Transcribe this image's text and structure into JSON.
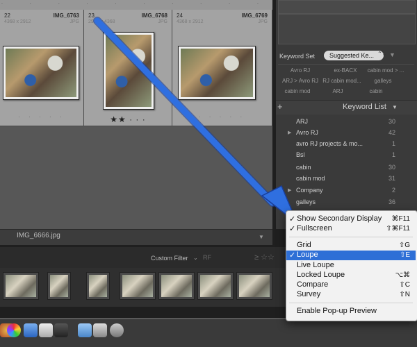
{
  "grid": {
    "top_dots": "· · · · · · · · · · · ·",
    "cells": [
      {
        "num": "22",
        "name": "IMG_6763",
        "dims": "4368 x 2912",
        "type": "JPG",
        "dots": "· · · · ·",
        "stars": ""
      },
      {
        "num": "23",
        "name": "IMG_6768",
        "dims": "2912 x 4368",
        "type": "JPG",
        "dots": "",
        "stars": "★★ · · ·"
      },
      {
        "num": "24",
        "name": "IMG_6769",
        "dims": "4368 x 2912",
        "type": "JPG",
        "dots": "· · · · ·",
        "stars": ""
      }
    ]
  },
  "status": {
    "filename": "IMG_6666.jpg"
  },
  "keyword_set": {
    "label": "Keyword Set",
    "value": "Suggested Ke...",
    "chevron": "⌃⌄",
    "suggestions": [
      "Avro RJ",
      "ex-BACX",
      "cabin mod > ...",
      "ARJ > Avro RJ",
      "RJ cabin mod...",
      "galleys",
      "cabin mod",
      "ARJ",
      "cabin"
    ]
  },
  "keyword_list": {
    "add": "+",
    "title": "Keyword List",
    "items": [
      {
        "name": "ARJ",
        "count": "30",
        "expand": ""
      },
      {
        "name": "Avro RJ",
        "count": "42",
        "expand": "▶"
      },
      {
        "name": "avro RJ projects & mo...",
        "count": "1",
        "expand": ""
      },
      {
        "name": "Bsl",
        "count": "1",
        "expand": ""
      },
      {
        "name": "cabin",
        "count": "30",
        "expand": ""
      },
      {
        "name": "cabin mod",
        "count": "31",
        "expand": ""
      },
      {
        "name": "Company",
        "count": "2",
        "expand": "▶"
      },
      {
        "name": "galleys",
        "count": "36",
        "expand": ""
      }
    ]
  },
  "filter": {
    "label": "Custom Filter",
    "chevron": "⌄",
    "rf": "RF",
    "stars": "≥ ☆☆"
  },
  "context_menu": {
    "items": [
      {
        "label": "Show Secondary Display",
        "shortcut": "⌘F11",
        "checked": true,
        "highlighted": false
      },
      {
        "label": "Fullscreen",
        "shortcut": "⇧⌘F11",
        "checked": true,
        "highlighted": false
      },
      {
        "label": "Grid",
        "shortcut": "⇧G",
        "checked": false,
        "highlighted": false
      },
      {
        "label": "Loupe",
        "shortcut": "⇧E",
        "checked": true,
        "highlighted": true
      },
      {
        "label": "Live Loupe",
        "shortcut": "",
        "checked": false,
        "highlighted": false
      },
      {
        "label": "Locked Loupe",
        "shortcut": "⌥⌘",
        "checked": false,
        "highlighted": false
      },
      {
        "label": "Compare",
        "shortcut": "⇧C",
        "checked": false,
        "highlighted": false
      },
      {
        "label": "Survey",
        "shortcut": "⇧N",
        "checked": false,
        "highlighted": false
      },
      {
        "label": "Enable Pop-up Preview",
        "shortcut": "",
        "checked": false,
        "highlighted": false
      }
    ],
    "check_glyph": "✓"
  },
  "colors": {
    "annotation_arrow": "#2f6fe0",
    "menu_highlight": "#2e6fd6"
  }
}
